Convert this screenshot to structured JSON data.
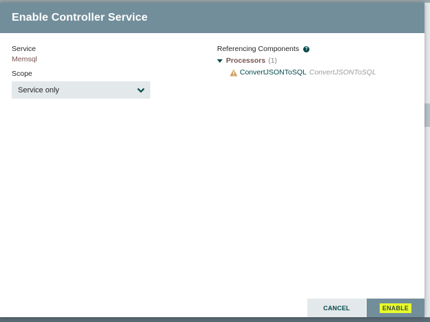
{
  "dialog": {
    "title": "Enable Controller Service"
  },
  "service": {
    "label": "Service",
    "value": "Memsql"
  },
  "scope": {
    "label": "Scope",
    "selected": "Service only"
  },
  "referencing": {
    "label": "Referencing Components",
    "help_icon_glyph": "?",
    "processors": {
      "label": "Processors",
      "count": "(1)",
      "items": [
        {
          "name": "ConvertJSONToSQL",
          "type": "ConvertJSONToSQL",
          "status_icon": "warning-icon"
        }
      ]
    }
  },
  "footer": {
    "cancel_label": "CANCEL",
    "enable_label": "ENABLE"
  },
  "colors": {
    "header": "#728e9b",
    "accent": "#004849",
    "value_text": "#775351",
    "highlight": "#e9ff2b",
    "warning": "#cf9f5d"
  }
}
